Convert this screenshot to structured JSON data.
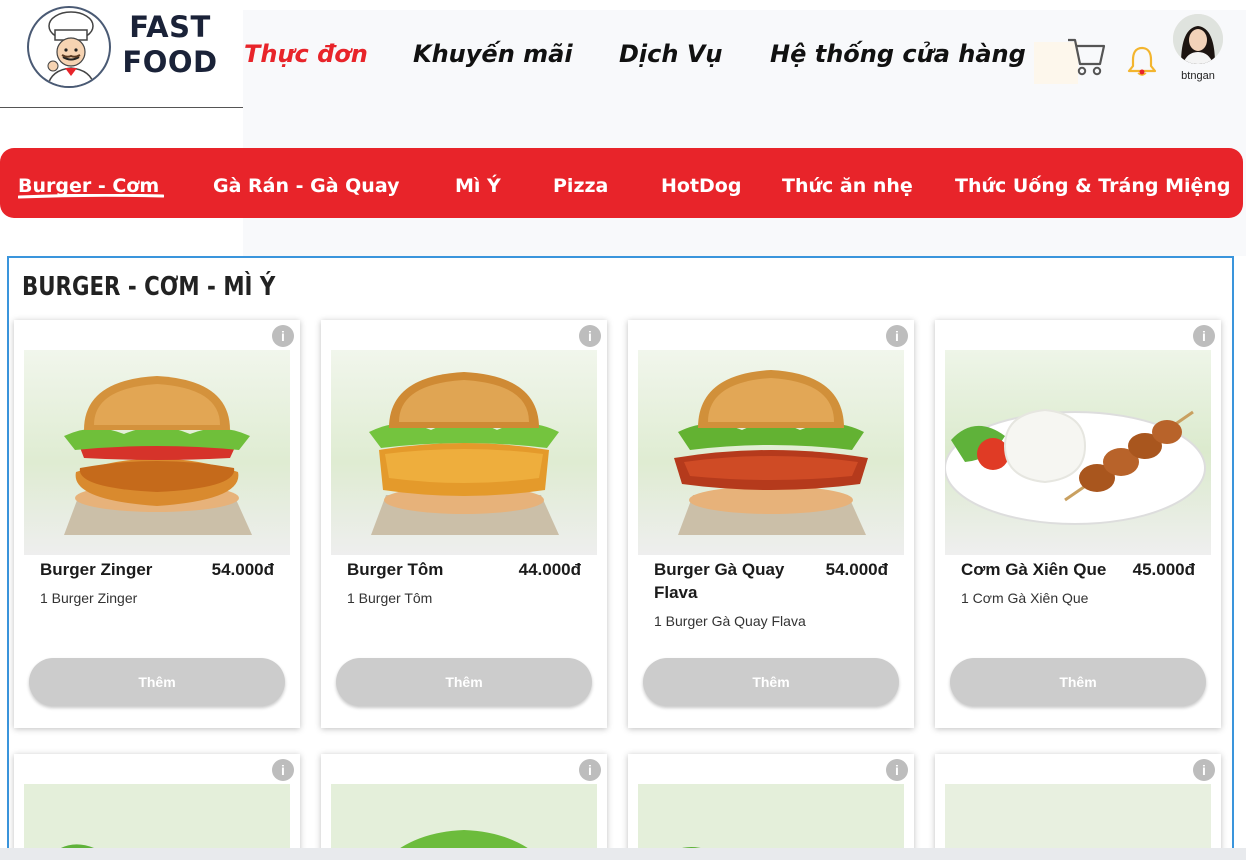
{
  "brand": {
    "line1": "FAST",
    "line2": "FOOD"
  },
  "nav": {
    "menu": "Thực đơn",
    "promotions": "Khuyến mãi",
    "services": "Dịch Vụ",
    "stores": "Hệ thống cửa hàng"
  },
  "user": {
    "name": "btngan"
  },
  "categories": [
    "Burger - Cơm",
    "Gà Rán - Gà Quay",
    "Mì Ý",
    "Pizza",
    "HotDog",
    "Thức ăn nhẹ",
    "Thức Uống & Tráng Miệng"
  ],
  "section": {
    "title": "BURGER - CƠM - MÌ Ý"
  },
  "products": [
    {
      "name": "Burger Zinger",
      "price": "54.000đ",
      "desc": "1 Burger Zinger",
      "button": "Thêm"
    },
    {
      "name": "Burger Tôm",
      "price": "44.000đ",
      "desc": "1 Burger Tôm",
      "button": "Thêm"
    },
    {
      "name": "Burger Gà Quay Flava",
      "price": "54.000đ",
      "desc": "1 Burger Gà Quay Flava",
      "button": "Thêm"
    },
    {
      "name": "Cơm Gà Xiên Que",
      "price": "45.000đ",
      "desc": "1 Cơm Gà Xiên Que",
      "button": "Thêm"
    }
  ],
  "info_symbol": "i",
  "colors": {
    "accent": "#e8242a",
    "section_border": "#3a95dc",
    "button_disabled": "#cccccc"
  }
}
